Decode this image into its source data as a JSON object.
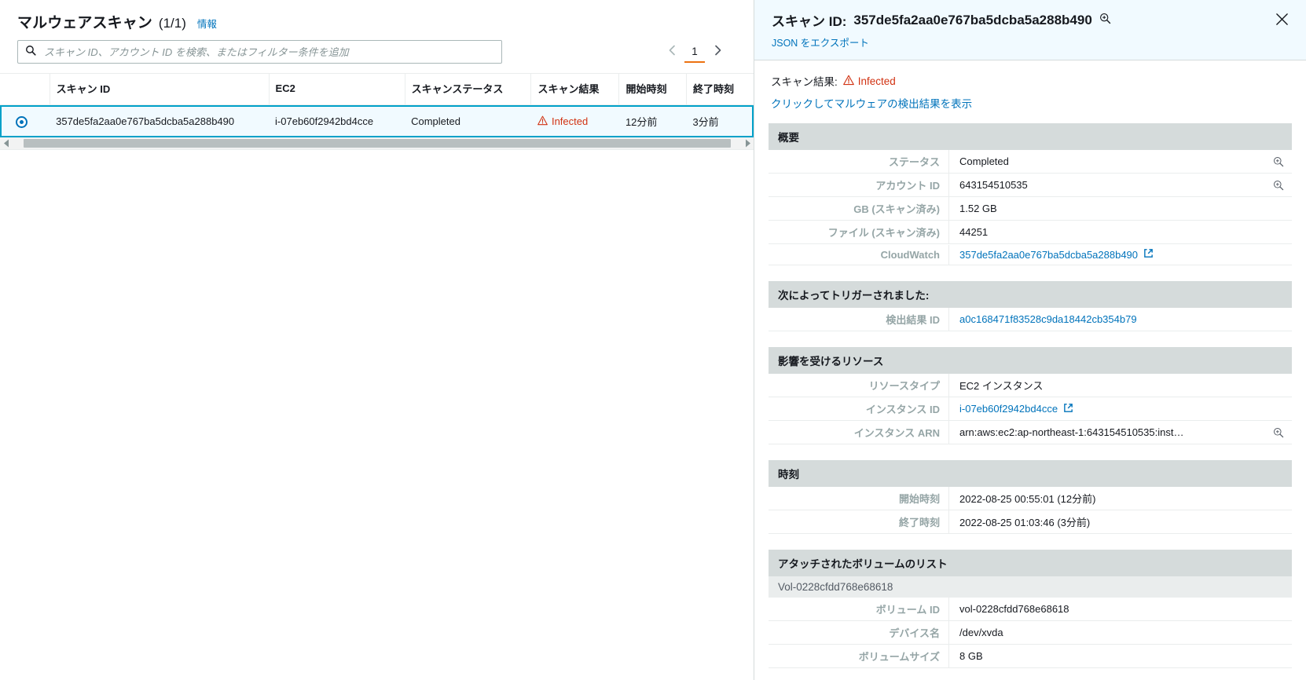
{
  "colors": {
    "accent": "#0073bb",
    "danger": "#d13212",
    "orange": "#ec7211",
    "panel_header_bg": "#f1faff",
    "section_bg": "#d5dbdb",
    "selected_row_bg": "#f1faff",
    "selected_row_border": "#00a1c9"
  },
  "left": {
    "title": "マルウェアスキャン",
    "count": "(1/1)",
    "info_label": "情報",
    "search": {
      "placeholder": "スキャン ID、アカウント ID を検索、またはフィルター条件を追加",
      "value": "",
      "icon": "search-icon"
    },
    "pagination": {
      "prev_icon": "chevron-left-icon",
      "next_icon": "chevron-right-icon",
      "current_page": "1"
    },
    "table": {
      "columns": [
        "スキャン ID",
        "EC2",
        "スキャンステータス",
        "スキャン結果",
        "開始時刻",
        "終了時刻"
      ],
      "rows": [
        {
          "selected": true,
          "scan_id": "357de5fa2aa0e767ba5dcba5a288b490",
          "ec2": "i-07eb60f2942bd4cce",
          "status": "Completed",
          "result": "Infected",
          "result_icon": "warning-triangle-icon",
          "start": "12分前",
          "end": "3分前"
        }
      ]
    }
  },
  "right": {
    "title_prefix": "スキャン ID:",
    "title_value": "357de5fa2aa0e767ba5dcba5a288b490",
    "title_magnifier_icon": "magnifier-plus-icon",
    "close_icon": "close-icon",
    "export_json_label": "JSON をエクスポート",
    "scan_result_label": "スキャン結果:",
    "scan_result_value": "Infected",
    "scan_result_icon": "warning-triangle-icon",
    "findings_link": "クリックしてマルウェアの検出結果を表示",
    "sections": [
      {
        "title": "概要",
        "rows": [
          {
            "key": "ステータス",
            "value": "Completed",
            "magnifier": true
          },
          {
            "key": "アカウント ID",
            "value": "643154510535",
            "magnifier": true
          },
          {
            "key": "GB (スキャン済み)",
            "value": "1.52 GB",
            "magnifier": false
          },
          {
            "key": "ファイル (スキャン済み)",
            "value": "44251",
            "magnifier": false
          },
          {
            "key": "CloudWatch",
            "value": "357de5fa2aa0e767ba5dcba5a288b490",
            "link": true,
            "external": true,
            "magnifier": false
          }
        ]
      },
      {
        "title": "次によってトリガーされました:",
        "rows": [
          {
            "key": "検出結果 ID",
            "value": "a0c168471f83528c9da18442cb354b79",
            "link": true,
            "external": false,
            "magnifier": false
          }
        ]
      },
      {
        "title": "影響を受けるリソース",
        "rows": [
          {
            "key": "リソースタイプ",
            "value": "EC2 インスタンス",
            "magnifier": false
          },
          {
            "key": "インスタンス ID",
            "value": "i-07eb60f2942bd4cce",
            "link": true,
            "external": true,
            "magnifier": false
          },
          {
            "key": "インスタンス ARN",
            "value": "arn:aws:ec2:ap-northeast-1:643154510535:inst…",
            "magnifier": true
          }
        ]
      },
      {
        "title": "時刻",
        "rows": [
          {
            "key": "開始時刻",
            "value": "2022-08-25 00:55:01 (12分前)",
            "magnifier": false
          },
          {
            "key": "終了時刻",
            "value": "2022-08-25 01:03:46 (3分前)",
            "magnifier": false
          }
        ]
      },
      {
        "title": "アタッチされたボリュームのリスト",
        "subtitle": "Vol-0228cfdd768e68618",
        "rows": [
          {
            "key": "ボリューム ID",
            "value": "vol-0228cfdd768e68618",
            "magnifier": false
          },
          {
            "key": "デバイス名",
            "value": "/dev/xvda",
            "magnifier": false
          },
          {
            "key": "ボリュームサイズ",
            "value": "8 GB",
            "magnifier": false
          }
        ]
      }
    ]
  }
}
